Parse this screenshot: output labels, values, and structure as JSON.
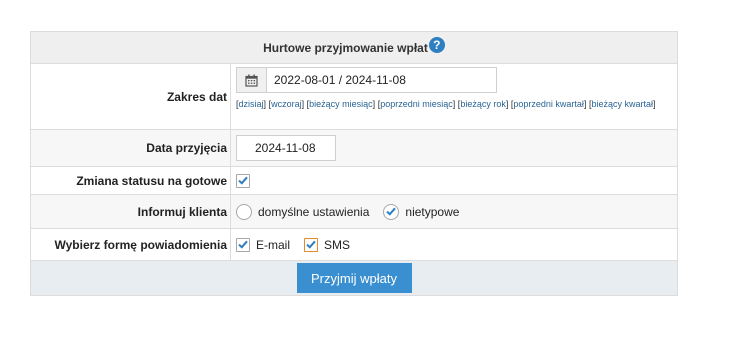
{
  "panel": {
    "title": "Hurtowe przyjmowanie wpłat",
    "help_icon": "question-circle-icon",
    "help_glyph": "?"
  },
  "date_range": {
    "label": "Zakres dat",
    "calendar_icon": "calendar-icon",
    "value": "2022-08-01 / 2024-11-08",
    "shortcuts": [
      "dzisiaj",
      "wczoraj",
      "bieżący miesiąc",
      "poprzedni miesiąc",
      "bieżący rok",
      "poprzedni kwartał",
      "bieżący kwartał"
    ]
  },
  "accept_date": {
    "label": "Data przyjęcia",
    "value": "2024-11-08"
  },
  "status_change": {
    "label": "Zmiana statusu na gotowe",
    "checked": true
  },
  "inform_client": {
    "label": "Informuj klienta",
    "options": [
      {
        "label": "domyślne ustawienia",
        "selected": false
      },
      {
        "label": "nietypowe",
        "selected": true
      }
    ]
  },
  "notification": {
    "label": "Wybierz formę powiadomienia",
    "options": [
      {
        "label": "E-mail",
        "checked": true
      },
      {
        "label": "SMS",
        "checked": true
      }
    ]
  },
  "submit": {
    "label": "Przyjmij wpłaty"
  },
  "colors": {
    "accent": "#3a8fd0",
    "check": "#2d7fc1",
    "sms_border": "#e58a2a"
  }
}
